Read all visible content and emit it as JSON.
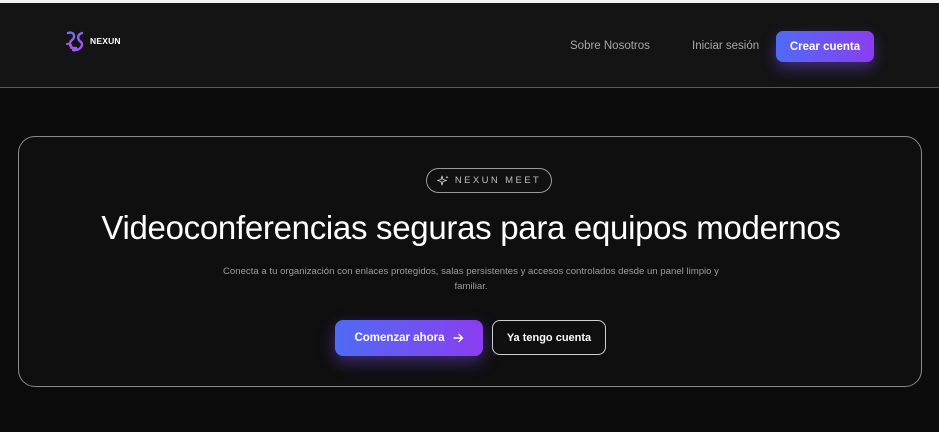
{
  "header": {
    "brand_name": "NEXUN",
    "nav": {
      "about": "Sobre Nosotros",
      "login": "Iniciar sesión",
      "create_account": "Crear cuenta"
    }
  },
  "hero": {
    "badge": "NEXUN MEET",
    "title": "Videoconferencias seguras para equipos modernos",
    "subtitle": "Conecta a tu organización con enlaces protegidos, salas persistentes y accesos controlados desde un panel limpio y familiar.",
    "primary_cta": "Comenzar ahora",
    "secondary_cta": "Ya tengo cuenta"
  },
  "icons": {
    "logo": "nexun-logo-icon",
    "badge": "sparkles-icon",
    "cta_arrow": "arrow-right-icon"
  },
  "colors": {
    "background": "#0c0c0c",
    "header_background": "#141414",
    "gradient_start": "#4f6bf5",
    "gradient_end": "#8b3df0",
    "muted_text": "#a7a7a7"
  }
}
